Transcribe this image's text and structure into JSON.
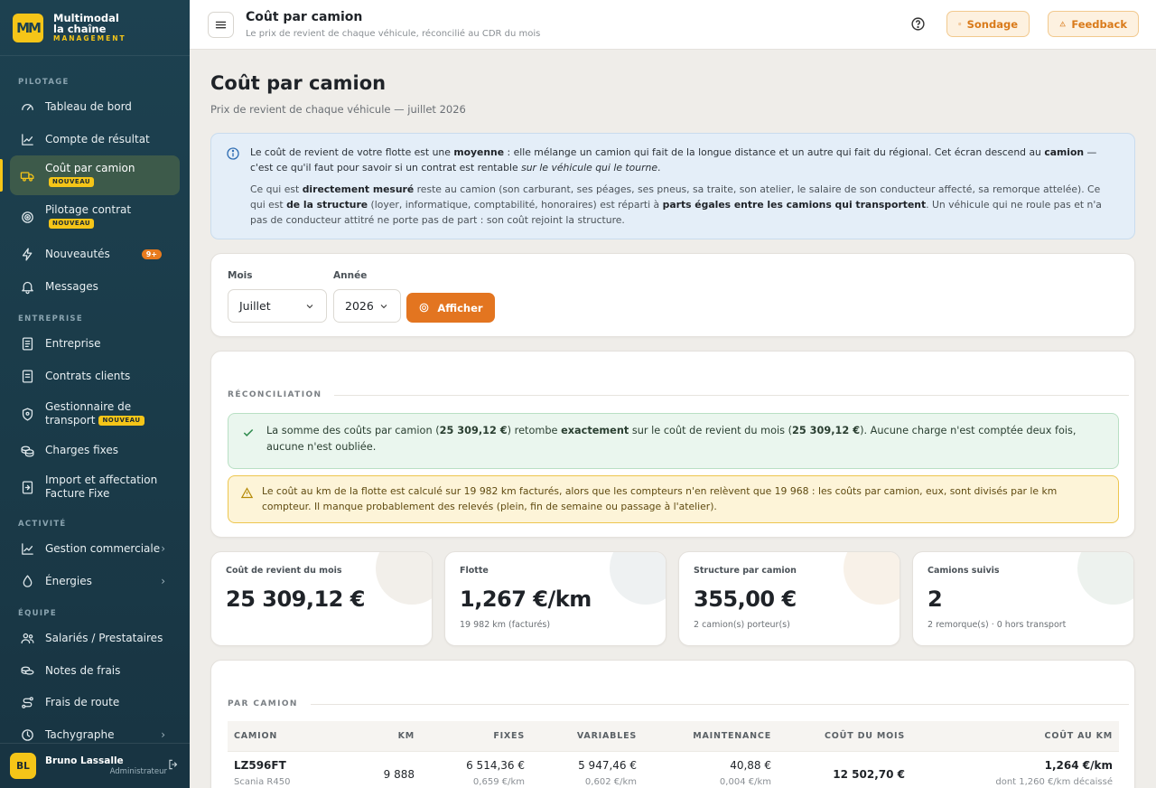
{
  "brand": {
    "logo": "MM",
    "line1": "Multimodal",
    "line2": "la chaîne",
    "line3": "MANAGEMENT"
  },
  "sidebar": {
    "sections": {
      "pilotage": "PILOTAGE",
      "entreprise": "ENTREPRISE",
      "activite": "ACTIVITÉ",
      "equipe": "ÉQUIPE"
    },
    "items": [
      {
        "label": "Tableau de bord",
        "icon": "gauge-icon"
      },
      {
        "label": "Compte de résultat",
        "icon": "chart-line-icon"
      },
      {
        "label": "Coût par camion",
        "icon": "truck-icon",
        "badge": "NOUVEAU",
        "active": true
      },
      {
        "label": "Pilotage contrat",
        "icon": "target-icon",
        "badge": "NOUVEAU"
      },
      {
        "label": "Nouveautés",
        "icon": "bolt-icon",
        "count": "9+"
      },
      {
        "label": "Messages",
        "icon": "bell-icon"
      },
      {
        "label": "Entreprise",
        "icon": "document-icon"
      },
      {
        "label": "Contrats clients",
        "icon": "file-icon"
      },
      {
        "label": "Gestionnaire de transport",
        "icon": "shield-icon",
        "badge": "NOUVEAU"
      },
      {
        "label": "Charges fixes",
        "icon": "coins-icon"
      },
      {
        "label": "Import et affectation Facture Fixe",
        "icon": "file-import-icon"
      },
      {
        "label": "Gestion commerciale",
        "icon": "chart-bar-icon"
      },
      {
        "label": "Énergies",
        "icon": "drop-icon"
      },
      {
        "label": "Salariés / Prestataires",
        "icon": "users-icon"
      },
      {
        "label": "Notes de frais",
        "icon": "wallet-icon"
      },
      {
        "label": "Frais de route",
        "icon": "route-icon"
      },
      {
        "label": "Tachygraphe",
        "icon": "clock-icon"
      }
    ],
    "user": {
      "initials": "BL",
      "name": "Bruno Lassalle",
      "role": "Administrateur"
    }
  },
  "topbar": {
    "title": "Coût par camion",
    "subtitle": "Le prix de revient de chaque véhicule, réconcilié au CDR du mois",
    "survey_label": "Sondage",
    "feedback_label": "Feedback"
  },
  "page": {
    "title": "Coût par camion",
    "subtitle": "Prix de revient de chaque véhicule — juillet 2026"
  },
  "info": {
    "p1_a": "Le coût de revient de votre flotte est une ",
    "p1_b": "moyenne",
    "p1_c": " : elle mélange un camion qui fait de la longue distance et un autre qui fait du régional. Cet écran descend au ",
    "p1_d": "camion",
    "p1_e": " — c'est ce qu'il faut pour savoir si un contrat est rentable ",
    "p1_f": "sur le véhicule qui le tourne",
    "p1_g": ".",
    "p2_a": "Ce qui est ",
    "p2_b": "directement mesuré",
    "p2_c": " reste au camion (son carburant, ses péages, ses pneus, sa traite, son atelier, le salaire de son conducteur affecté, sa remorque attelée). Ce qui est ",
    "p2_d": "de la structure",
    "p2_e": " (loyer, informatique, comptabilité, honoraires) est réparti à ",
    "p2_f": "parts égales entre les camions qui transportent",
    "p2_g": ". Un véhicule qui ne roule pas et n'a pas de conducteur attitré ne porte pas de part : son coût rejoint la structure."
  },
  "filters": {
    "month_label": "Mois",
    "month_value": "Juillet",
    "year_label": "Année",
    "year_value": "2026",
    "submit_label": "Afficher"
  },
  "reconciliation": {
    "heading": "RÉCONCILIATION",
    "ok_a": "La somme des coûts par camion (",
    "ok_b": "25 309,12 €",
    "ok_c": ") retombe ",
    "ok_d": "exactement",
    "ok_e": " sur le coût de revient du mois (",
    "ok_f": "25 309,12 €",
    "ok_g": "). Aucune charge n'est comptée deux fois, aucune n'est oubliée.",
    "warning": "Le coût au km de la flotte est calculé sur 19 982 km facturés, alors que les compteurs n'en relèvent que 19 968 : les coûts par camion, eux, sont divisés par le km compteur. Il manque probablement des relevés (plein, fin de semaine ou passage à l'atelier)."
  },
  "stats": [
    {
      "label": "Coût de revient du mois",
      "value": "25 309,12 €",
      "sub": "",
      "deco": "#f2efea"
    },
    {
      "label": "Flotte",
      "value": "1,267 €/km",
      "sub": "19 982 km (facturés)",
      "deco": "#eef1f2"
    },
    {
      "label": "Structure par camion",
      "value": "355,00 €",
      "sub": "2 camion(s) porteur(s)",
      "deco": "#f8f1e8"
    },
    {
      "label": "Camions suivis",
      "value": "2",
      "sub": "2 remorque(s) · 0 hors transport",
      "deco": "#edf2ee"
    }
  ],
  "per_truck": {
    "heading": "PAR CAMION",
    "columns": [
      "CAMION",
      "KM",
      "FIXES",
      "VARIABLES",
      "MAINTENANCE",
      "COÛT DU MOIS",
      "COÛT AU KM"
    ],
    "rows": [
      {
        "plate": "LZ596FT",
        "model": "Scania R450",
        "km": "9 888",
        "fixes": "6 514,36 €",
        "fixes_km": "0,659 €/km",
        "variables": "5 947,46 €",
        "variables_km": "0,602 €/km",
        "maintenance": "40,88 €",
        "maintenance_km": "0,004 €/km",
        "cout_mois": "12 502,70 €",
        "cout_km": "1,264 €/km",
        "cout_km_sub": "dont 1,260 €/km décaissé"
      }
    ]
  },
  "colors": {
    "sidebar": "#1d4150",
    "accent_yellow": "#f5c518",
    "accent_orange": "#e37520",
    "info_bg": "#e4eef8",
    "ok_bg": "#eaf6ee",
    "warn_bg": "#fdf4d8"
  }
}
